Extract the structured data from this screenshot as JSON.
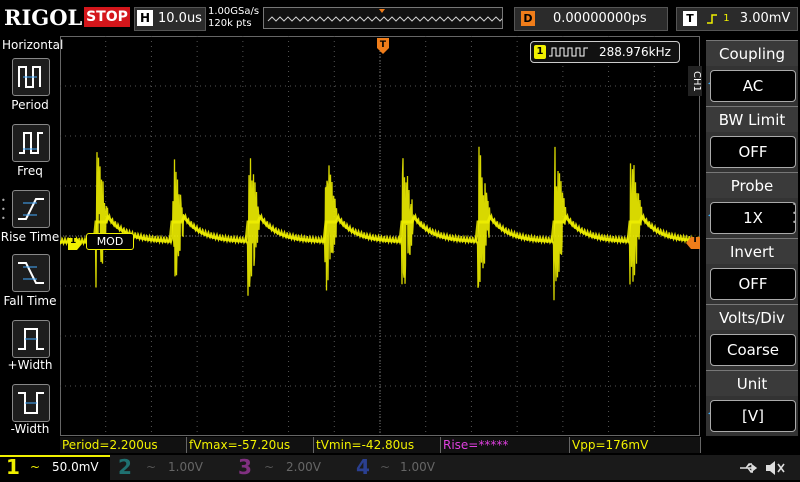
{
  "brand": "RIGOL",
  "run_status": "STOP",
  "horizontal": {
    "letter": "H",
    "timebase": "10.0us"
  },
  "acquisition": {
    "sample_rate": "1.00GSa/s",
    "memory_depth": "120k pts"
  },
  "delay": {
    "letter": "D",
    "value": "0.00000000ps"
  },
  "trigger": {
    "letter": "T",
    "level": "3.00mV",
    "source_channel": "1"
  },
  "left_panel": {
    "title": "Horizontal",
    "items": [
      {
        "label": "Period",
        "icon": "period-icon"
      },
      {
        "label": "Freq",
        "icon": "freq-icon"
      },
      {
        "label": "Rise Time",
        "icon": "rise-time-icon"
      },
      {
        "label": "Fall Time",
        "icon": "fall-time-icon"
      },
      {
        "label": "+Width",
        "icon": "positive-width-icon"
      },
      {
        "label": "-Width",
        "icon": "negative-width-icon"
      }
    ]
  },
  "frequency_counter": {
    "channel": "1",
    "value": "288.976kHz"
  },
  "waveform": {
    "channel_marker": "1",
    "label": "MOD",
    "trigger_marker": "T",
    "color": "#f0f000"
  },
  "right_menu": {
    "channel_tab": "CH1",
    "items": [
      {
        "title": "Coupling",
        "value": "AC",
        "has_arrow": true
      },
      {
        "title": "BW Limit",
        "value": "OFF",
        "has_arrow": false
      },
      {
        "title": "Probe",
        "value": "1X",
        "has_arrow": true
      },
      {
        "title": "Invert",
        "value": "OFF",
        "has_arrow": false
      },
      {
        "title": "Volts/Div",
        "value": "Coarse",
        "has_arrow": false
      },
      {
        "title": "Unit",
        "value": "[V]",
        "has_arrow": true
      }
    ]
  },
  "measurements": [
    {
      "text": "Period=2.200us"
    },
    {
      "text": "fVmax=-57.20us"
    },
    {
      "text": "tVmin=-42.80us"
    },
    {
      "text": "Rise=*****"
    },
    {
      "text": "Vpp=176mV"
    }
  ],
  "channels": [
    {
      "num": "1",
      "coupling": "~",
      "scale": "50.0mV",
      "color": "#f0f000",
      "active": true
    },
    {
      "num": "2",
      "coupling": "~",
      "scale": "1.00V",
      "color": "#00c8c8",
      "active": false
    },
    {
      "num": "3",
      "coupling": "~",
      "scale": "2.00V",
      "color": "#e040e0",
      "active": false
    },
    {
      "num": "4",
      "coupling": "~",
      "scale": "1.00V",
      "color": "#3060ff",
      "active": false
    }
  ],
  "status_icons": [
    "usb-icon",
    "speaker-muted-icon"
  ]
}
